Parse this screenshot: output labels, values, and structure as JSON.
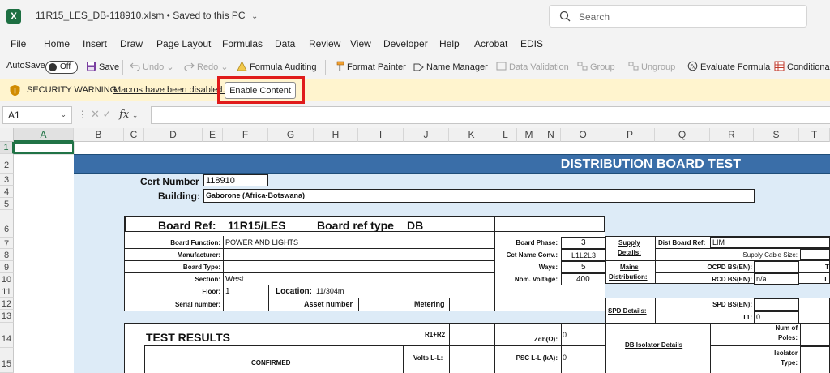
{
  "titlebar": {
    "filename": "11R15_LES_DB-118910.xlsm",
    "status": "• Saved to this PC",
    "search_placeholder": "Search"
  },
  "menu": [
    "File",
    "Home",
    "Insert",
    "Draw",
    "Page Layout",
    "Formulas",
    "Data",
    "Review",
    "View",
    "Developer",
    "Help",
    "Acrobat",
    "EDIS"
  ],
  "toolbar": {
    "autosave": "AutoSave",
    "autosave_state": "Off",
    "save": "Save",
    "undo": "Undo",
    "redo": "Redo",
    "formula_auditing": "Formula Auditing",
    "format_painter": "Format Painter",
    "name_manager": "Name Manager",
    "data_validation": "Data Validation",
    "group": "Group",
    "ungroup": "Ungroup",
    "evaluate_formula": "Evaluate Formula",
    "conditional": "Conditiona"
  },
  "security": {
    "title": "SECURITY WARNING",
    "message": "Macros have been disabled.",
    "button": "Enable Content"
  },
  "formula_bar": {
    "name_box": "A1",
    "fx": "fx"
  },
  "columns": [
    "A",
    "B",
    "C",
    "D",
    "E",
    "F",
    "G",
    "H",
    "I",
    "J",
    "K",
    "L",
    "M",
    "N",
    "O",
    "P",
    "Q",
    "R",
    "S",
    "T"
  ],
  "rows": [
    "1",
    "2",
    "3",
    "4",
    "5",
    "6",
    "7",
    "8",
    "9",
    "10",
    "11",
    "12",
    "13",
    "14",
    "15"
  ],
  "sheet": {
    "title": "DISTRIBUTION BOARD TEST",
    "cert_label": "Cert Number",
    "cert_value": "118910",
    "building_label": "Building:",
    "building_value": "Gaborone (Africa-Botswana)",
    "board_ref_label": "Board Ref:",
    "board_ref_value": "11R15/LES",
    "board_type_label": "Board ref type",
    "board_type_value": "DB",
    "board_function_label": "Board Function:",
    "board_function_value": "POWER AND LIGHTS",
    "manufacturer_label": "Manufacturer:",
    "board_type2_label": "Board Type:",
    "section_label": "Section:",
    "section_value": "West",
    "floor_label": "Floor:",
    "floor_value": "1",
    "location_label": "Location:",
    "location_value": "11/304m",
    "serial_label": "Serial number:",
    "asset_label": "Asset number",
    "metering_label": "Metering",
    "board_phase_label": "Board Phase:",
    "board_phase_value": "3",
    "cct_name_label": "Cct Name Conv.:",
    "cct_name_value": "L1L2L3",
    "ways_label": "Ways:",
    "ways_value": "5",
    "nom_voltage_label": "Nom. Voltage:",
    "nom_voltage_value": "400",
    "supply_details_1": "Supply",
    "supply_details_2": "Details:",
    "dist_board_ref_label": "Dist Board Ref:",
    "dist_board_ref_value": "LIM",
    "supply_cable_label": "Supply Cable Size:",
    "mains_1": "Mains",
    "mains_2": "Distribution:",
    "ocpd_label": "OCPD BS(EN):",
    "rcd_label": "RCD BS(EN):",
    "rcd_value": "n/a",
    "spd_details_label": "SPD Details:",
    "spd_bs_label": "SPD BS(EN):",
    "t1_label": "T1:",
    "t1_value": "0",
    "test_results": "TEST RESULTS",
    "confirmed": "CONFIRMED",
    "r1r2_label": "R1+R2",
    "volts_label": "Volts L-L:",
    "zdb_label": "Zdb(Ω):",
    "zdb_value": "0",
    "psc_label": "PSC L-L (kA):",
    "psc_value": "0",
    "db_isolator": "DB Isolator Details",
    "num_poles_1": "Num of",
    "num_poles_2": "Poles:",
    "isolator_1": "Isolator",
    "isolator_2": "Type:",
    "t_cut_1": "T",
    "t_cut_2": "T"
  }
}
